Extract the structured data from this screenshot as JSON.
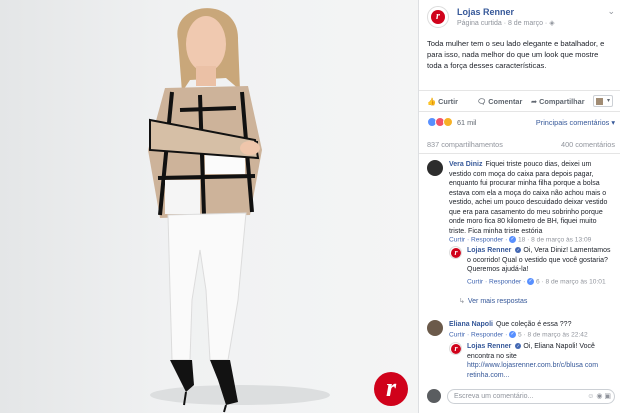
{
  "page": {
    "name": "Lojas Renner",
    "meta": "Página curtida · 8 de março ·",
    "logo_letter": "r"
  },
  "post": {
    "text": "Toda mulher tem o seu lado elegante e batalhador, e para isso, nada melhor do que um look que mostre toda a força desses características."
  },
  "actions": {
    "like": "Curtir",
    "comment": "Comentar",
    "share": "Compartilhar"
  },
  "reactions": {
    "count": "61 mil",
    "order": "Principais comentários",
    "colors": {
      "like": "#5890ff",
      "love": "#f25268",
      "wow": "#f7b125"
    }
  },
  "stats": {
    "shares": "837 compartilhamentos",
    "comments": "400 comentários"
  },
  "comments": [
    {
      "author": "Vera Diniz",
      "text": "Fiquei triste pouco dias, deixei um vestido com moça do caixa para depois pagar, enquanto fui procurar minha filha porque a bolsa estava com ela a moça do caixa não achou mais o vestido, achei um pouco descuidado deixar vestido que era para casamento do meu sobrinho porque onde moro fica 80 kilometro de BH, fiquei muito triste. Fica minha triste estória",
      "actions": "Curtir · Responder ·",
      "likes": "18",
      "date": "· 8 de março às 13:09"
    },
    {
      "author": "Lojas Renner",
      "text": "Oi, Vera Diniz! Lamentamos o ocorrido! Qual o vestido que você gostaria? Queremos ajudá-la!",
      "actions": "Curtir · Responder ·",
      "likes": "6",
      "date": "· 8 de março às 10:01"
    },
    {
      "author": "Eliana Napoli",
      "text": "Que coleção é essa ???",
      "actions": "Curtir · Responder ·",
      "likes": "5",
      "date": "· 8 de março às 22:42"
    },
    {
      "author": "Lojas Renner",
      "text": "Oi, Eliana Napoli! Você encontra no site",
      "link": "http://www.lojasrenner.com.br/c/blusa com",
      "link2": "retinha.com..."
    }
  ],
  "more_replies": "Ver mais respostas",
  "composer": {
    "placeholder": "Escreva um comentário..."
  }
}
